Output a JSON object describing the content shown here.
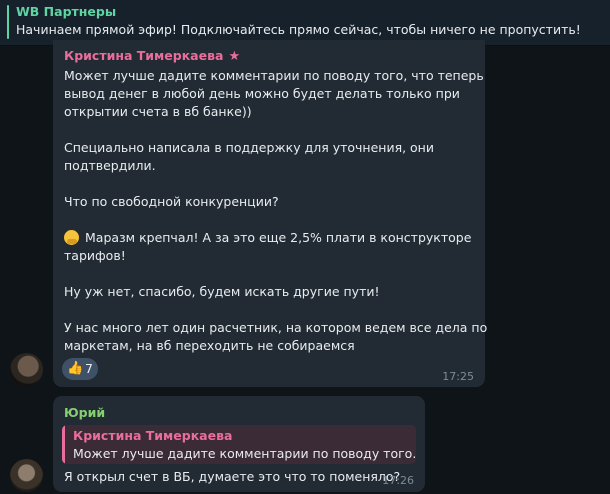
{
  "pinned": {
    "title": "WB Партнеры",
    "text": "Начинаем прямой эфир! Подключайтесь прямо сейчас, чтобы ничего не пропустить!"
  },
  "messages": [
    {
      "author": "Кристина Тимеркаева",
      "badge_icon": "star-icon",
      "lines": [
        "Может лучше дадите комментарии по поводу того, что теперь",
        "вывод денег в любой день можно будет делать только при",
        "открытии счета в вб банке))",
        "",
        "Специально написала в поддержку для уточнения, они",
        "подтвердили.",
        "",
        "Что по свободной конкуренции?",
        "",
        "Маразм крепчал! А за это еще 2,5% плати в конструкторе",
        "тарифов!",
        "",
        "Ну уж нет, спасибо, будем искать другие пути!",
        "",
        "У нас много лет один расчетник, на котором ведем все дела по",
        "маркетам, на вб переходить не собираемся"
      ],
      "reaction": {
        "icon": "thumbs-up-icon",
        "count": "7"
      },
      "time": "17:25",
      "author_color": "#e96e9b"
    },
    {
      "author": "Юрий",
      "reply_to": {
        "author": "Кристина Тимеркаева",
        "text": "Может лучше дадите комментарии по поводу того...."
      },
      "text": "Я открыл счет в ВБ, думаете это что то поменяло?",
      "time": "17:26",
      "author_color": "#85d06f"
    }
  ]
}
